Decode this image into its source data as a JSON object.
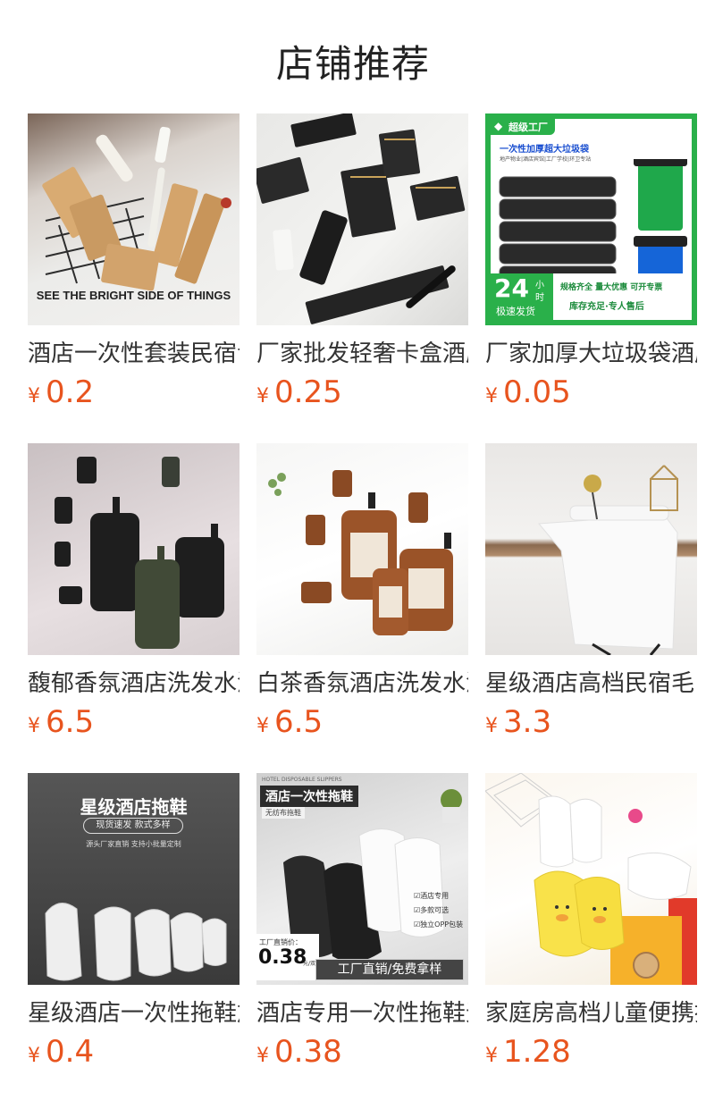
{
  "header": {
    "title": "店铺推荐"
  },
  "products": [
    {
      "name": "酒店一次性套装民宿专用",
      "price": "0.2",
      "currency": "¥",
      "image_caption": "SEE THE BRIGHT SIDE OF THINGS"
    },
    {
      "name": "厂家批发轻奢卡盒酒店一次性用品",
      "price": "0.25",
      "currency": "¥"
    },
    {
      "name": "厂家加厚大垃圾袋酒店物业专用",
      "price": "0.05",
      "currency": "¥",
      "image_text": {
        "badge": "超级工厂",
        "headline": "一次性加厚超大垃圾袋",
        "sub": "地产物业|酒店宾馆|工厂学校|环卫专站",
        "big_num": "24",
        "big_unit_top": "小",
        "big_unit_bottom": "时",
        "ship": "极速发货",
        "line1": "规格齐全 量大优惠 可开专票",
        "line2": "库存充足·专人售后"
      }
    },
    {
      "name": "馥郁香氛酒店洗发水沐浴露",
      "price": "6.5",
      "currency": "¥"
    },
    {
      "name": "白茶香氛酒店洗发水沐浴露",
      "price": "6.5",
      "currency": "¥"
    },
    {
      "name": "星级酒店高档民宿毛巾",
      "price": "3.3",
      "currency": "¥"
    },
    {
      "name": "星级酒店一次性拖鞋加厚",
      "price": "0.4",
      "currency": "¥",
      "image_text": {
        "headline": "星级酒店拖鞋",
        "pill": "现货速发  款式多样",
        "sub": "源头厂家直销 支持小批量定制"
      }
    },
    {
      "name": "酒店专用一次性拖鞋无纺布",
      "price": "0.38",
      "currency": "¥",
      "image_text": {
        "top_small": "HOTEL DISPOSABLE SLIPPERS",
        "headline": "酒店一次性拖鞋",
        "sub": "无纺布拖鞋",
        "check1": "酒店专用",
        "check2": "多款可选",
        "check3": "独立OPP包装",
        "factory_label": "工厂直销价：",
        "factory_price": "0.38",
        "factory_unit": "元/双",
        "banner": "工厂直销/免费拿样"
      }
    },
    {
      "name": "家庭房高档儿童便携拖鞋",
      "price": "1.28",
      "currency": "¥"
    }
  ]
}
